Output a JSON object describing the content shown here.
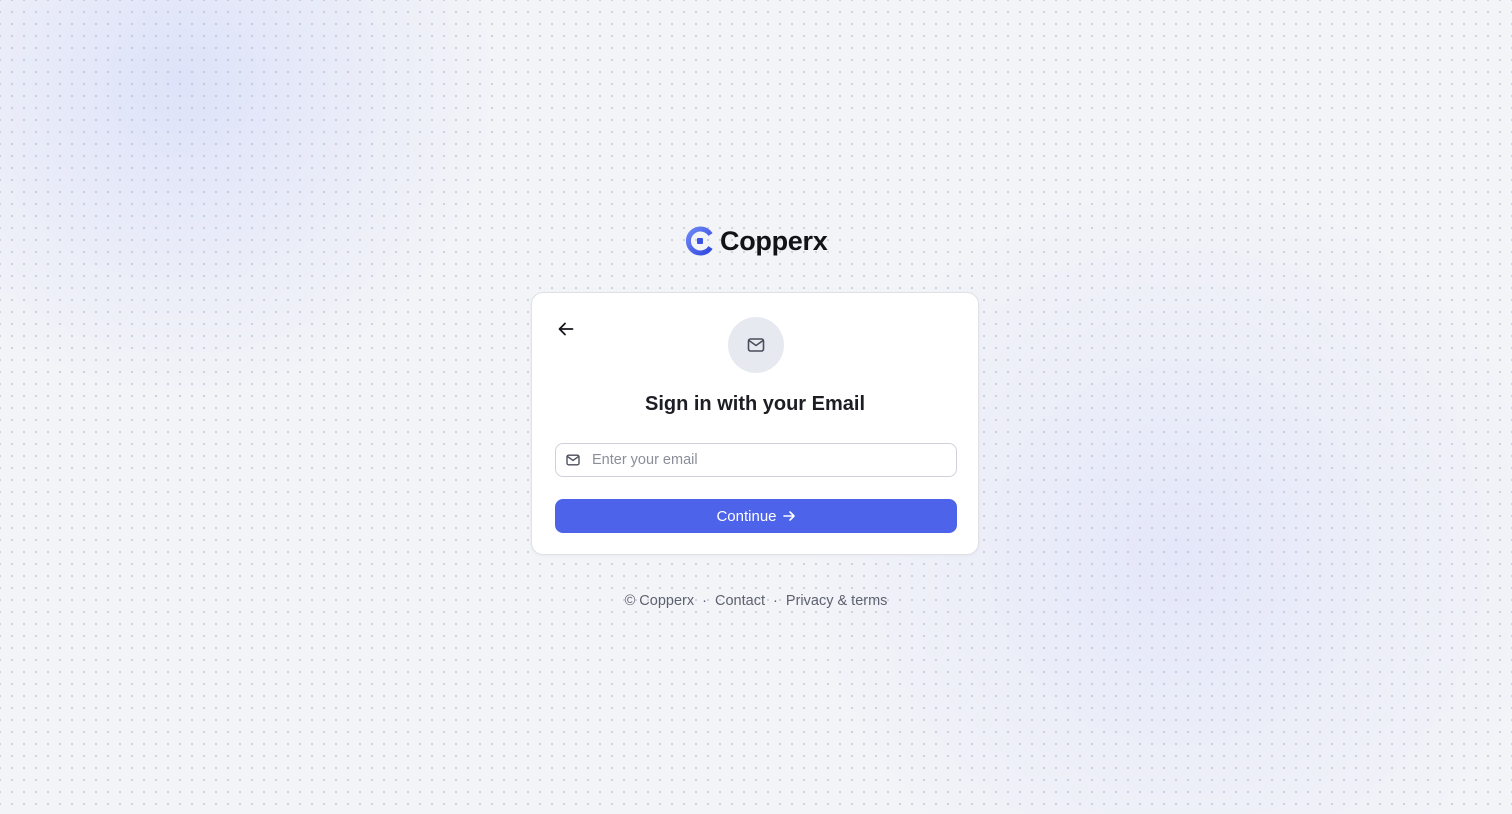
{
  "brand": {
    "name": "Copperx",
    "logo_icon": "copperx-logo-icon",
    "accent_color": "#4c63ea"
  },
  "card": {
    "back_icon": "arrow-left-icon",
    "badge_icon": "mail-icon",
    "title": "Sign in with your Email",
    "email_field": {
      "icon": "mail-icon",
      "placeholder": "Enter your email",
      "value": ""
    },
    "continue_button": {
      "label": "Continue",
      "icon": "arrow-right-icon"
    }
  },
  "footer": {
    "copyright": "© Copperx",
    "separator": "·",
    "contact": "Contact",
    "privacy": "Privacy & terms"
  }
}
